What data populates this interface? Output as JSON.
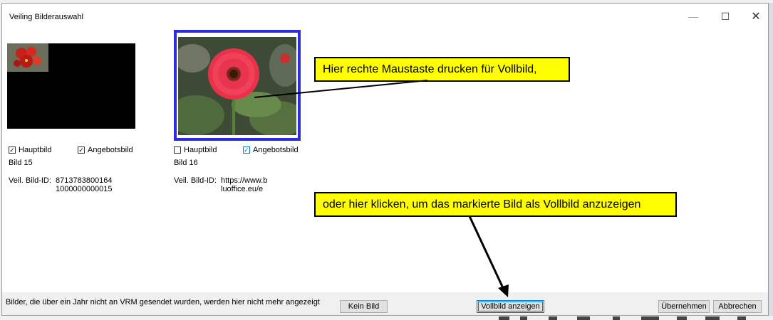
{
  "window": {
    "title": "Veiling Bilderauswahl",
    "minimize_glyph": "—",
    "maximize_glyph": "☐",
    "close_glyph": "✕"
  },
  "images": [
    {
      "hauptbild_label": "Hauptbild",
      "hauptbild_checked": true,
      "angebotsbild_label": "Angebotsbild",
      "angebotsbild_checked": true,
      "bild_label": "Bild 15",
      "veil_label": "Veil. Bild-ID:",
      "veil_value": "8713783800164\n1000000000015"
    },
    {
      "hauptbild_label": "Hauptbild",
      "hauptbild_checked": false,
      "angebotsbild_label": "Angebotsbild",
      "angebotsbild_checked": true,
      "bild_label": "Bild 16",
      "veil_label": "Veil. Bild-ID:",
      "veil_value": "https://www.b\nluoffice.eu/e"
    }
  ],
  "status_text": "Bilder, die über ein Jahr nicht an VRM gesendet wurden, werden hier nicht mehr angezeigt",
  "buttons": {
    "kein_bild": "Kein Bild",
    "vollbild": "Vollbild anzeigen",
    "uebernehmen": "Übernehmen",
    "abbrechen": "Abbrechen"
  },
  "callouts": {
    "right_click": "Hier rechte Maustaste drucken für Vollbild,",
    "click_here": "oder hier klicken, um das markierte Bild als Vollbild anzuzeigen"
  },
  "colors": {
    "callout_bg": "#ffff00",
    "selection": "#2d2de0",
    "focus": "#0078d7"
  }
}
